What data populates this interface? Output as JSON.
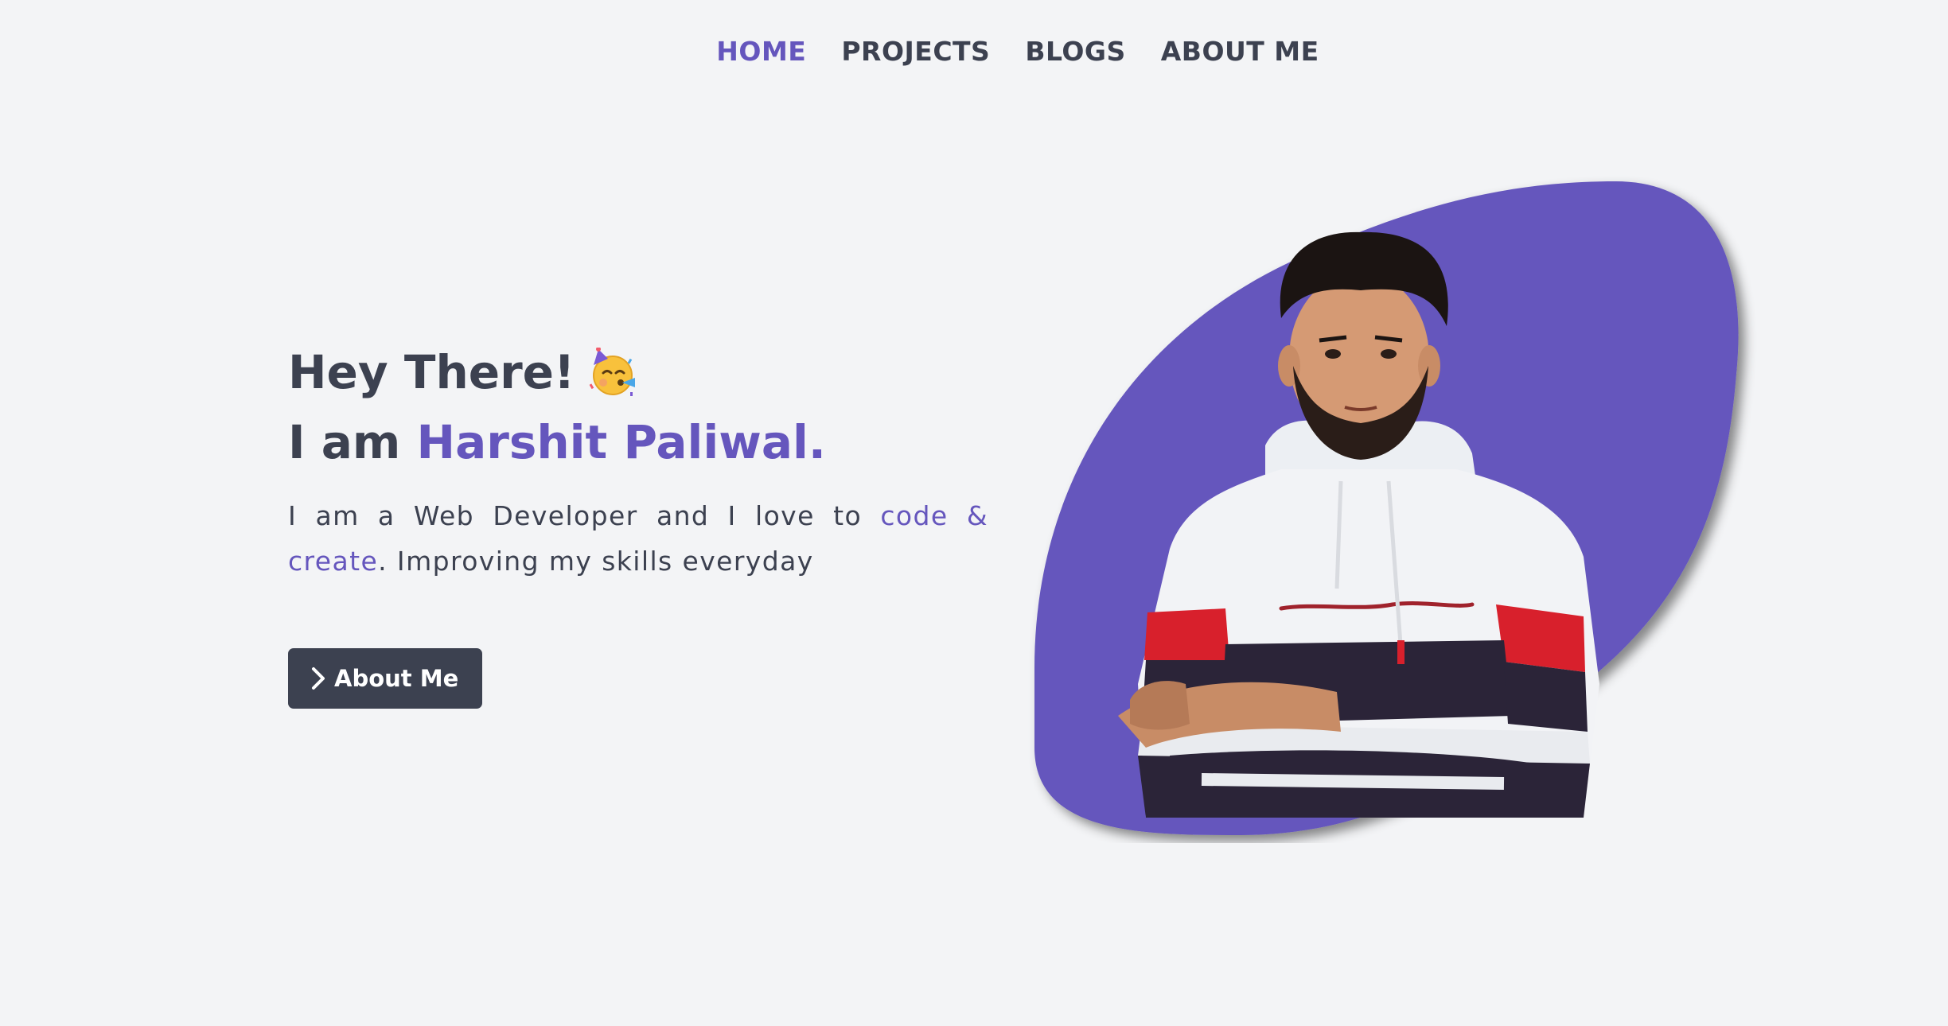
{
  "nav": {
    "items": [
      {
        "label": "HOME",
        "active": true
      },
      {
        "label": "PROJECTS",
        "active": false
      },
      {
        "label": "BLOGS",
        "active": false
      },
      {
        "label": "ABOUT ME",
        "active": false
      }
    ]
  },
  "hero": {
    "greeting": "Hey There!",
    "greeting_icon": "party-face-icon",
    "intro_prefix": "I am ",
    "name": "Harshit Paliwal.",
    "bio_prefix": "I am a Web Developer and I love to ",
    "bio_highlight": "code & create",
    "bio_suffix": ". Improving my skills everyday",
    "button_label": "About Me",
    "button_icon": "chevron-right-icon"
  },
  "portrait": {
    "image": "person-photo",
    "blob_color": "#6556bd"
  },
  "colors": {
    "accent": "#6556bd",
    "text": "#3c4150",
    "background": "#f3f4f6"
  }
}
